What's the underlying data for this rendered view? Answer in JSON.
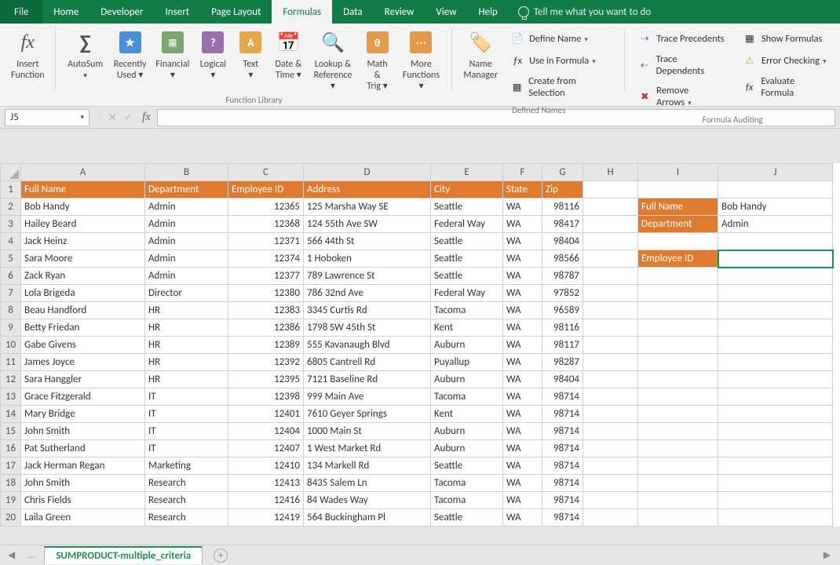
{
  "menu": {
    "file": "File",
    "tabs": [
      "Home",
      "Developer",
      "Insert",
      "Page Layout",
      "Formulas",
      "Data",
      "Review",
      "View",
      "Help"
    ],
    "active": "Formulas",
    "tell": "Tell me what you want to do"
  },
  "ribbon": {
    "groups": {
      "insertfn": {
        "label": "Insert\nFunction"
      },
      "library": {
        "title": "Function Library",
        "items": [
          {
            "name": "autosumbtn",
            "label": "AutoSum",
            "sub": "",
            "dd": true,
            "glyph": "∑",
            "bg": "transparent",
            "fg": "#555",
            "fs": "26px"
          },
          {
            "name": "recentbtn",
            "label": "Recently",
            "sub": "Used ▾",
            "glyph": "★",
            "bg": "#4a90d9"
          },
          {
            "name": "financialbtn",
            "label": "Financial",
            "sub": "▾",
            "glyph": "≣",
            "bg": "#7aa86f"
          },
          {
            "name": "logicalbtn",
            "label": "Logical",
            "sub": "▾",
            "glyph": "?",
            "bg": "#9a6fb0"
          },
          {
            "name": "textbtn",
            "label": "Text",
            "sub": "▾",
            "glyph": "A",
            "bg": "#e3a94a"
          },
          {
            "name": "datebtn",
            "label": "Date &",
            "sub": "Time ▾",
            "glyph": "📅",
            "bg": "#d9664a",
            "plain": true
          },
          {
            "name": "lookupbtn",
            "label": "Lookup &",
            "sub": "Reference ▾",
            "glyph": "🔍",
            "bg": "#4a90d9",
            "plain": true
          },
          {
            "name": "mathbtn",
            "label": "Math &",
            "sub": "Trig ▾",
            "glyph": "θ",
            "bg": "#e39a4a"
          },
          {
            "name": "morebtn",
            "label": "More",
            "sub": "Functions ▾",
            "glyph": "⋯",
            "bg": "#e39a4a"
          }
        ]
      },
      "names": {
        "title": "Defined Names",
        "manager": "Name\nManager",
        "define": "Define Name",
        "use": "Use in Formula",
        "create": "Create from Selection"
      },
      "audit": {
        "title": "Formula Auditing",
        "tp": "Trace Precedents",
        "sf": "Show Formulas",
        "td": "Trace Dependents",
        "ec": "Error Checking",
        "ra": "Remove Arrows",
        "ef": "Evaluate Formula"
      }
    }
  },
  "fbar": {
    "cell": "J5",
    "formula": ""
  },
  "grid": {
    "cols": [
      "A",
      "B",
      "C",
      "D",
      "E",
      "F",
      "G",
      "H",
      "I",
      "J"
    ],
    "headers": [
      "Full Name",
      "Department",
      "Employee ID",
      "Address",
      "City",
      "State",
      "Zip"
    ],
    "lookup": {
      "fullname_lbl": "Full Name",
      "fullname_val": "Bob Handy",
      "dept_lbl": "Department",
      "dept_val": "Admin",
      "emp_lbl": "Employee ID",
      "emp_val": ""
    },
    "rows": [
      [
        "Bob Handy",
        "Admin",
        "12365",
        "125 Marsha Way SE",
        "Seattle",
        "WA",
        "98116"
      ],
      [
        "Hailey Beard",
        "Admin",
        "12368",
        "124 55th Ave SW",
        "Federal Way",
        "WA",
        "98417"
      ],
      [
        "Jack Heinz",
        "Admin",
        "12371",
        "566 44th St",
        "Seattle",
        "WA",
        "98404"
      ],
      [
        "Sara Moore",
        "Admin",
        "12374",
        "1 Hoboken",
        "Seattle",
        "WA",
        "98566"
      ],
      [
        "Zack Ryan",
        "Admin",
        "12377",
        "789 Lawrence St",
        "Seattle",
        "WA",
        "98787"
      ],
      [
        "Lola Brigeda",
        "Director",
        "12380",
        "786 32nd Ave",
        "Federal Way",
        "WA",
        "97852"
      ],
      [
        "Beau Handford",
        "HR",
        "12383",
        "3345 Curtis Rd",
        "Tacoma",
        "WA",
        "96589"
      ],
      [
        "Betty Friedan",
        "HR",
        "12386",
        "1798 SW 45th St",
        "Kent",
        "WA",
        "98116"
      ],
      [
        "Gabe Givens",
        "HR",
        "12389",
        "555 Kavanaugh Blvd",
        "Auburn",
        "WA",
        "98117"
      ],
      [
        "James Joyce",
        "HR",
        "12392",
        "6805 Cantrell Rd",
        "Puyallup",
        "WA",
        "98287"
      ],
      [
        "Sara Hanggler",
        "HR",
        "12395",
        "7121 Baseline Rd",
        "Auburn",
        "WA",
        "98404"
      ],
      [
        "Grace Fitzgerald",
        "IT",
        "12398",
        "999 Main Ave",
        "Tacoma",
        "WA",
        "98714"
      ],
      [
        "Mary Bridge",
        "IT",
        "12401",
        "7610 Geyer Springs",
        "Kent",
        "WA",
        "98714"
      ],
      [
        "John Smith",
        "IT",
        "12404",
        "1000 Main St",
        "Auburn",
        "WA",
        "98714"
      ],
      [
        "Pat Sutherland",
        "IT",
        "12407",
        "1 West Market Rd",
        "Auburn",
        "WA",
        "98714"
      ],
      [
        "Jack Herman Regan",
        "Marketing",
        "12410",
        "134 Markell Rd",
        "Seattle",
        "WA",
        "98714"
      ],
      [
        "John Smith",
        "Research",
        "12413",
        "8435 Salem Ln",
        "Tacoma",
        "WA",
        "98714"
      ],
      [
        "Chris Fields",
        "Research",
        "12416",
        "84 Wades Way",
        "Tacoma",
        "WA",
        "98714"
      ],
      [
        "Laila Green",
        "Research",
        "12419",
        "564 Buckingham Pl",
        "Seattle",
        "WA",
        "98714"
      ]
    ]
  },
  "tabs": {
    "sheet": "SUMPRODUCT-multiple_criteria"
  }
}
